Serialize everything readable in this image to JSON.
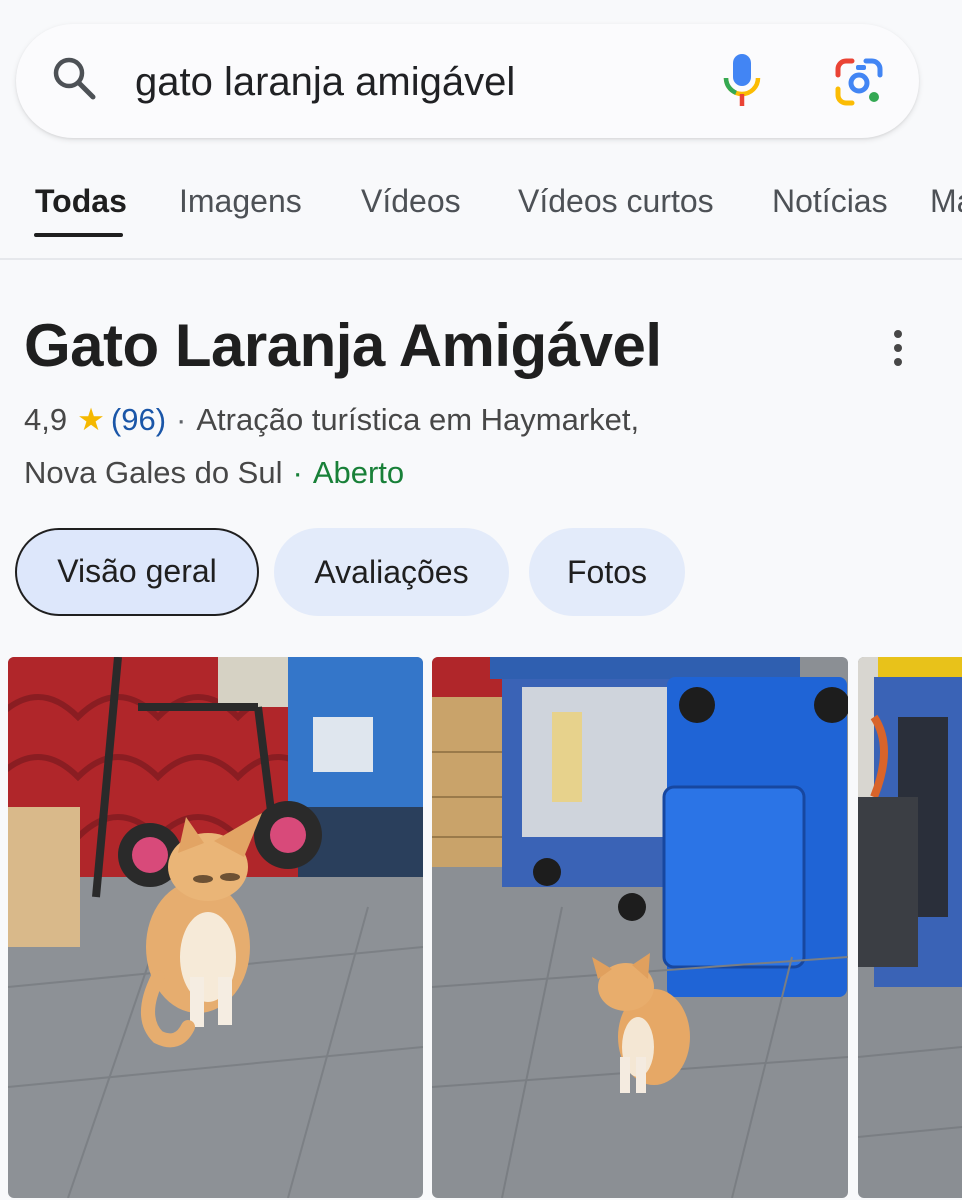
{
  "search": {
    "query": "gato laranja amigável"
  },
  "tabs": [
    "Todas",
    "Imagens",
    "Vídeos",
    "Vídeos curtos",
    "Notícias",
    "Ma"
  ],
  "place": {
    "title": "Gato Laranja Amigável",
    "rating": "4,9",
    "reviews": "(96)",
    "category": "Atração turística em Haymarket,",
    "region": "Nova Gales do Sul",
    "status": "Aberto",
    "separator": "·",
    "star": "★"
  },
  "chips": [
    "Visão geral",
    "Avaliações",
    "Fotos"
  ],
  "photos": [
    {
      "icon": "photo-cat-by-trolley"
    },
    {
      "icon": "photo-cat-by-bins"
    },
    {
      "icon": "photo-bins-partial"
    }
  ],
  "colors": {
    "accent_blue": "#1a56a8",
    "open_green": "#188038",
    "star_yellow": "#f5b800",
    "chip_bg": "#e3ebfa"
  }
}
